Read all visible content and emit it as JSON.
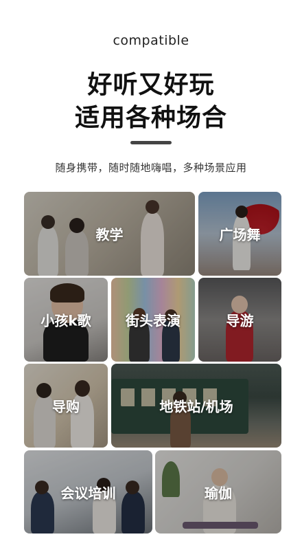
{
  "header": {
    "eyebrow": "compatible",
    "headline_line1": "好听又好玩",
    "headline_line2": "适用各种场合",
    "subtitle": "随身携带，随时随地嗨唱，多种场景应用"
  },
  "scenes": [
    {
      "label": "教学"
    },
    {
      "label": "广场舞"
    },
    {
      "label": "小孩k歌"
    },
    {
      "label": "街头表演"
    },
    {
      "label": "导游"
    },
    {
      "label": "导购"
    },
    {
      "label": "地铁站/机场"
    },
    {
      "label": "会议培训"
    },
    {
      "label": "瑜伽"
    }
  ],
  "colors": {
    "accent_divider": "#444444",
    "headline": "#111111"
  }
}
